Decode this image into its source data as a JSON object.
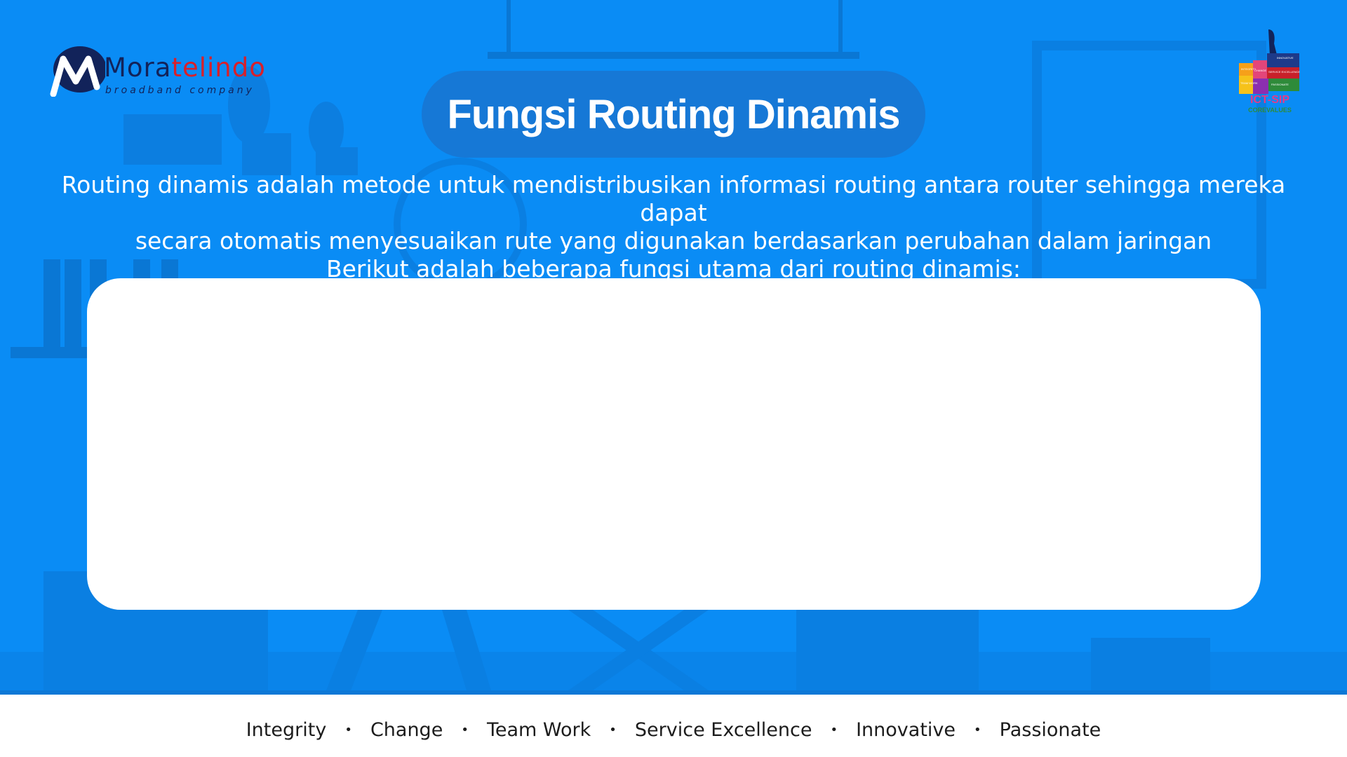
{
  "brand": {
    "name_part1": "Mora",
    "name_part2": "telindo",
    "tagline": "broadband company"
  },
  "badge": {
    "icon": "thumbs-up-puzzle-icon",
    "pieces": [
      "INTEGRITY",
      "CHANGE",
      "INNOVATIVE",
      "SERVICE EXCELLENCE",
      "TEAM WORK",
      "PASSIONATE"
    ],
    "title": "ICT-SIP",
    "subtitle": "COREVALUES"
  },
  "slide": {
    "title": "Fungsi Routing Dinamis",
    "intro_lines": [
      "Routing dinamis adalah metode untuk mendistribusikan informasi routing antara router sehingga mereka dapat",
      "secara otomatis menyesuaikan rute yang digunakan berdasarkan perubahan dalam jaringan",
      "Berikut adalah beberapa fungsi utama dari routing dinamis:"
    ]
  },
  "footer": {
    "values": [
      "Integrity",
      "Change",
      "Team Work",
      "Service Excellence",
      "Innovative",
      "Passionate"
    ],
    "separator": "•"
  },
  "colors": {
    "background": "#0a8cf5",
    "title_pill": "#1678d6",
    "brand_navy": "#12235a",
    "brand_red": "#d8202a",
    "card": "#ffffff"
  }
}
